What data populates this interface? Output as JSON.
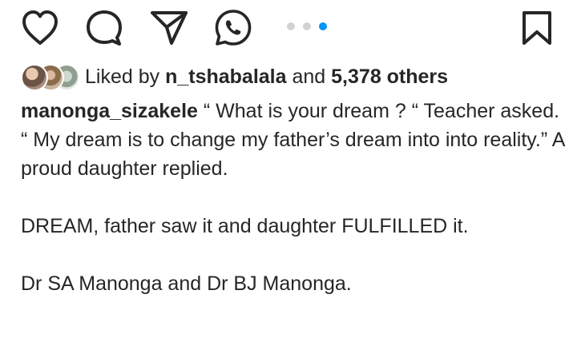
{
  "actions": {
    "icons": [
      "heart-icon",
      "comment-icon",
      "send-icon",
      "whatsapp-icon",
      "bookmark-icon"
    ],
    "carousel": {
      "count": 3,
      "active_index": 2,
      "active_color": "#0095f6",
      "inactive_color": "#d2d2d2"
    }
  },
  "likes": {
    "prefix": "Liked by",
    "user": "n_tshabalala",
    "middle": "and",
    "count": "5,378 others"
  },
  "caption": {
    "username": "manonga_sizakele",
    "lines": [
      "“ What is your dream ? “ Teacher asked.",
      "“ My dream is to change my father’s dream into into reality.” A proud daughter replied.",
      "DREAM, father saw it and daughter FULFILLED it.",
      "Dr SA Manonga and Dr BJ Manonga."
    ]
  }
}
